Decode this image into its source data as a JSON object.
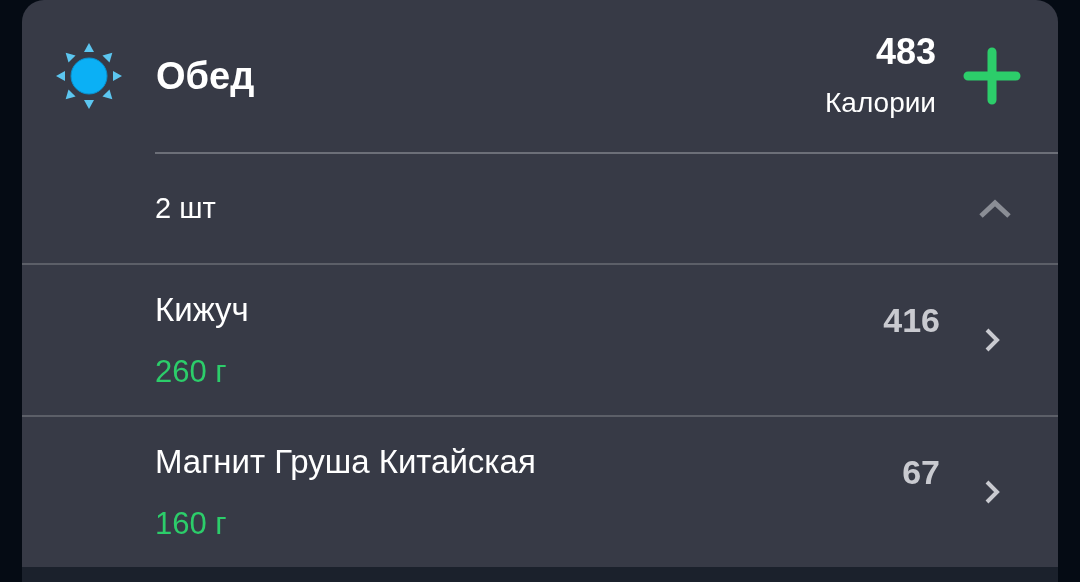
{
  "meal": {
    "title": "Обед",
    "calories": "483",
    "calories_label": "Калории"
  },
  "group": {
    "count": "2 шт",
    "expanded": true
  },
  "items": [
    {
      "name": "Кижуч",
      "amount": "260 г",
      "calories": "416"
    },
    {
      "name": "Магнит Груша Китайская",
      "amount": "160 г",
      "calories": "67"
    }
  ]
}
